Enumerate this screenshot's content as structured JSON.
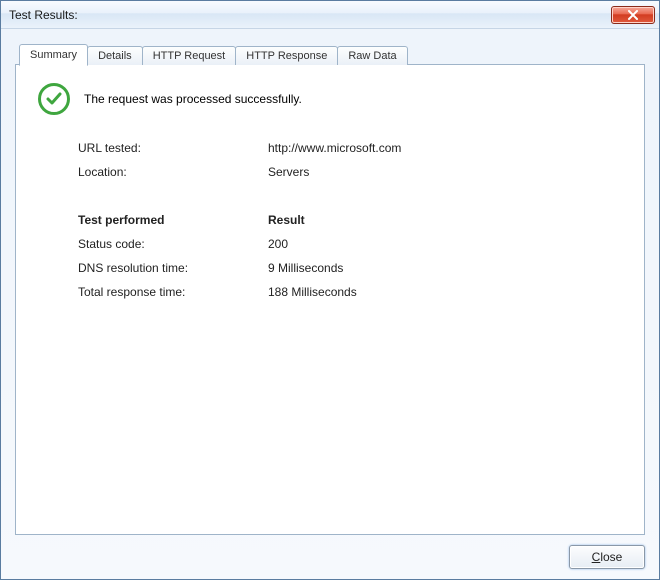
{
  "window": {
    "title": "Test Results:"
  },
  "tabs": {
    "summary": "Summary",
    "details": "Details",
    "http_request": "HTTP Request",
    "http_response": "HTTP Response",
    "raw_data": "Raw Data"
  },
  "status": {
    "message": "The request was processed successfully."
  },
  "info": {
    "url_label": "URL tested:",
    "url_value": "http://www.microsoft.com",
    "location_label": "Location:",
    "location_value": "Servers"
  },
  "results": {
    "header_test": "Test performed",
    "header_result": "Result",
    "status_code_label": "Status code:",
    "status_code_value": "200",
    "dns_label": "DNS resolution time:",
    "dns_value": "9 Milliseconds",
    "total_label": "Total response time:",
    "total_value": "188 Milliseconds"
  },
  "buttons": {
    "close": "Close"
  }
}
